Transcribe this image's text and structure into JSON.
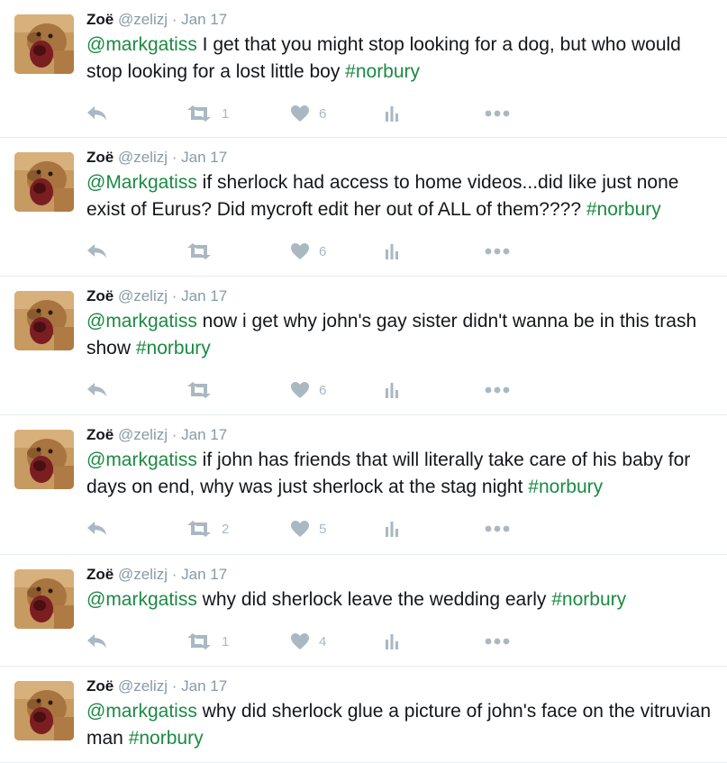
{
  "tweets": [
    {
      "name": "Zoë",
      "handle": "@zelizj",
      "sep": "·",
      "date": "Jan 17",
      "segments": [
        {
          "t": "@markgatiss",
          "k": "mention"
        },
        {
          "t": " I get that you might stop looking for a dog, but who would stop looking for a lost little boy ",
          "k": "text"
        },
        {
          "t": "#norbury",
          "k": "hashtag"
        }
      ],
      "retweets": "1",
      "likes": "6"
    },
    {
      "name": "Zoë",
      "handle": "@zelizj",
      "sep": "·",
      "date": "Jan 17",
      "segments": [
        {
          "t": "@Markgatiss",
          "k": "mention"
        },
        {
          "t": " if sherlock had access to home videos...did like just none exist of Eurus? Did mycroft edit her out of ALL of them???? ",
          "k": "text"
        },
        {
          "t": "#norbury",
          "k": "hashtag"
        }
      ],
      "retweets": "",
      "likes": "6"
    },
    {
      "name": "Zoë",
      "handle": "@zelizj",
      "sep": "·",
      "date": "Jan 17",
      "segments": [
        {
          "t": "@markgatiss",
          "k": "mention"
        },
        {
          "t": " now i get why john's gay sister didn't wanna be in this trash show ",
          "k": "text"
        },
        {
          "t": "#norbury",
          "k": "hashtag"
        }
      ],
      "retweets": "",
      "likes": "6"
    },
    {
      "name": "Zoë",
      "handle": "@zelizj",
      "sep": "·",
      "date": "Jan 17",
      "segments": [
        {
          "t": "@markgatiss",
          "k": "mention"
        },
        {
          "t": " if john has friends that will literally take care of his baby for days on end, why was just sherlock at the stag night ",
          "k": "text"
        },
        {
          "t": "#norbury",
          "k": "hashtag"
        }
      ],
      "retweets": "2",
      "likes": "5"
    },
    {
      "name": "Zoë",
      "handle": "@zelizj",
      "sep": "·",
      "date": "Jan 17",
      "segments": [
        {
          "t": "@markgatiss",
          "k": "mention"
        },
        {
          "t": " why did sherlock leave the wedding early ",
          "k": "text"
        },
        {
          "t": "#norbury",
          "k": "hashtag"
        }
      ],
      "retweets": "1",
      "likes": "4"
    },
    {
      "name": "Zoë",
      "handle": "@zelizj",
      "sep": "·",
      "date": "Jan 17",
      "segments": [
        {
          "t": "@markgatiss",
          "k": "mention"
        },
        {
          "t": " why did sherlock glue a picture of john's face on the vitruvian man ",
          "k": "text"
        },
        {
          "t": "#norbury",
          "k": "hashtag"
        }
      ],
      "retweets": "",
      "likes": ""
    }
  ],
  "icons": {
    "reply": "reply-icon",
    "retweet": "retweet-icon",
    "like": "heart-icon",
    "stats": "analytics-icon",
    "more": "more-icon"
  },
  "colors": {
    "link": "#1b8a43",
    "muted": "#8899a6",
    "action": "#aab8c2",
    "divider": "#e6ecf0"
  }
}
